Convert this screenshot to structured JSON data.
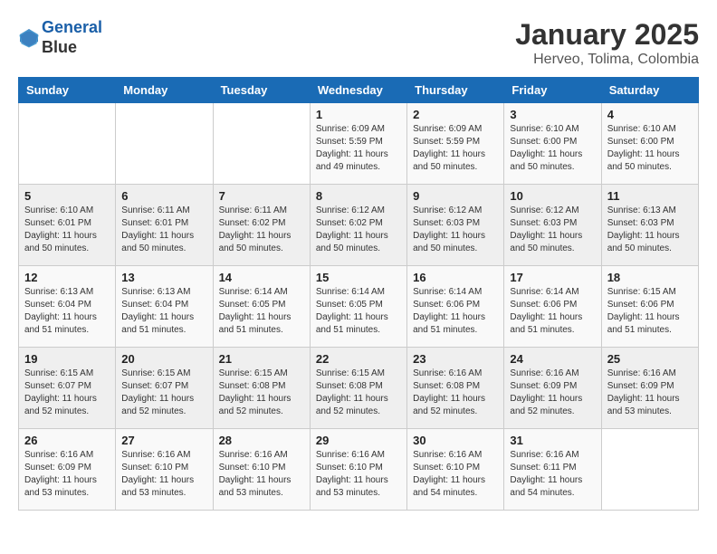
{
  "header": {
    "logo_line1": "General",
    "logo_line2": "Blue",
    "month": "January 2025",
    "location": "Herveo, Tolima, Colombia"
  },
  "weekdays": [
    "Sunday",
    "Monday",
    "Tuesday",
    "Wednesday",
    "Thursday",
    "Friday",
    "Saturday"
  ],
  "weeks": [
    [
      {
        "day": "",
        "info": ""
      },
      {
        "day": "",
        "info": ""
      },
      {
        "day": "",
        "info": ""
      },
      {
        "day": "1",
        "info": "Sunrise: 6:09 AM\nSunset: 5:59 PM\nDaylight: 11 hours\nand 49 minutes."
      },
      {
        "day": "2",
        "info": "Sunrise: 6:09 AM\nSunset: 5:59 PM\nDaylight: 11 hours\nand 50 minutes."
      },
      {
        "day": "3",
        "info": "Sunrise: 6:10 AM\nSunset: 6:00 PM\nDaylight: 11 hours\nand 50 minutes."
      },
      {
        "day": "4",
        "info": "Sunrise: 6:10 AM\nSunset: 6:00 PM\nDaylight: 11 hours\nand 50 minutes."
      }
    ],
    [
      {
        "day": "5",
        "info": "Sunrise: 6:10 AM\nSunset: 6:01 PM\nDaylight: 11 hours\nand 50 minutes."
      },
      {
        "day": "6",
        "info": "Sunrise: 6:11 AM\nSunset: 6:01 PM\nDaylight: 11 hours\nand 50 minutes."
      },
      {
        "day": "7",
        "info": "Sunrise: 6:11 AM\nSunset: 6:02 PM\nDaylight: 11 hours\nand 50 minutes."
      },
      {
        "day": "8",
        "info": "Sunrise: 6:12 AM\nSunset: 6:02 PM\nDaylight: 11 hours\nand 50 minutes."
      },
      {
        "day": "9",
        "info": "Sunrise: 6:12 AM\nSunset: 6:03 PM\nDaylight: 11 hours\nand 50 minutes."
      },
      {
        "day": "10",
        "info": "Sunrise: 6:12 AM\nSunset: 6:03 PM\nDaylight: 11 hours\nand 50 minutes."
      },
      {
        "day": "11",
        "info": "Sunrise: 6:13 AM\nSunset: 6:03 PM\nDaylight: 11 hours\nand 50 minutes."
      }
    ],
    [
      {
        "day": "12",
        "info": "Sunrise: 6:13 AM\nSunset: 6:04 PM\nDaylight: 11 hours\nand 51 minutes."
      },
      {
        "day": "13",
        "info": "Sunrise: 6:13 AM\nSunset: 6:04 PM\nDaylight: 11 hours\nand 51 minutes."
      },
      {
        "day": "14",
        "info": "Sunrise: 6:14 AM\nSunset: 6:05 PM\nDaylight: 11 hours\nand 51 minutes."
      },
      {
        "day": "15",
        "info": "Sunrise: 6:14 AM\nSunset: 6:05 PM\nDaylight: 11 hours\nand 51 minutes."
      },
      {
        "day": "16",
        "info": "Sunrise: 6:14 AM\nSunset: 6:06 PM\nDaylight: 11 hours\nand 51 minutes."
      },
      {
        "day": "17",
        "info": "Sunrise: 6:14 AM\nSunset: 6:06 PM\nDaylight: 11 hours\nand 51 minutes."
      },
      {
        "day": "18",
        "info": "Sunrise: 6:15 AM\nSunset: 6:06 PM\nDaylight: 11 hours\nand 51 minutes."
      }
    ],
    [
      {
        "day": "19",
        "info": "Sunrise: 6:15 AM\nSunset: 6:07 PM\nDaylight: 11 hours\nand 52 minutes."
      },
      {
        "day": "20",
        "info": "Sunrise: 6:15 AM\nSunset: 6:07 PM\nDaylight: 11 hours\nand 52 minutes."
      },
      {
        "day": "21",
        "info": "Sunrise: 6:15 AM\nSunset: 6:08 PM\nDaylight: 11 hours\nand 52 minutes."
      },
      {
        "day": "22",
        "info": "Sunrise: 6:15 AM\nSunset: 6:08 PM\nDaylight: 11 hours\nand 52 minutes."
      },
      {
        "day": "23",
        "info": "Sunrise: 6:16 AM\nSunset: 6:08 PM\nDaylight: 11 hours\nand 52 minutes."
      },
      {
        "day": "24",
        "info": "Sunrise: 6:16 AM\nSunset: 6:09 PM\nDaylight: 11 hours\nand 52 minutes."
      },
      {
        "day": "25",
        "info": "Sunrise: 6:16 AM\nSunset: 6:09 PM\nDaylight: 11 hours\nand 53 minutes."
      }
    ],
    [
      {
        "day": "26",
        "info": "Sunrise: 6:16 AM\nSunset: 6:09 PM\nDaylight: 11 hours\nand 53 minutes."
      },
      {
        "day": "27",
        "info": "Sunrise: 6:16 AM\nSunset: 6:10 PM\nDaylight: 11 hours\nand 53 minutes."
      },
      {
        "day": "28",
        "info": "Sunrise: 6:16 AM\nSunset: 6:10 PM\nDaylight: 11 hours\nand 53 minutes."
      },
      {
        "day": "29",
        "info": "Sunrise: 6:16 AM\nSunset: 6:10 PM\nDaylight: 11 hours\nand 53 minutes."
      },
      {
        "day": "30",
        "info": "Sunrise: 6:16 AM\nSunset: 6:10 PM\nDaylight: 11 hours\nand 54 minutes."
      },
      {
        "day": "31",
        "info": "Sunrise: 6:16 AM\nSunset: 6:11 PM\nDaylight: 11 hours\nand 54 minutes."
      },
      {
        "day": "",
        "info": ""
      }
    ]
  ]
}
